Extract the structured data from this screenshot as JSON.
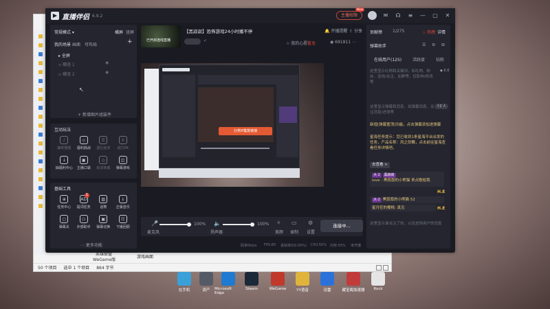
{
  "app": {
    "title": "直播伴侣",
    "version": "6.9.2",
    "right_pill": "主播权限",
    "new_tag": "New",
    "live_label": "开播提醒",
    "share": "分享"
  },
  "stream": {
    "title": "【黑寂寂】恐怖游戏24小时播不停",
    "thumb_text": "已开启连线直播",
    "wish": "我的心愿",
    "wish_value": "暂无",
    "fans_value": "691811",
    "connect": "连接中..."
  },
  "scene": {
    "mode": "常规模式",
    "mode_right1": "横屏",
    "mode_right2": "竖屏",
    "tabs": [
      "我的场景",
      "画面",
      "可布局"
    ],
    "items": [
      "全屏",
      "横竖 1",
      "横竖 2"
    ],
    "add": "新增图片组装件"
  },
  "play": {
    "title": "互动玩法",
    "items": [
      {
        "label": "抽奖答题",
        "icon": "♪",
        "active": false
      },
      {
        "label": "福利挑战",
        "icon": "◇",
        "active": true
      },
      {
        "label": "送礼玩法",
        "icon": "☰",
        "active": false
      },
      {
        "label": "战力PK",
        "icon": "⚲",
        "active": false
      },
      {
        "label": "抽福利中心",
        "icon": "↓",
        "active": true
      },
      {
        "label": "主播口袋",
        "icon": "▣",
        "active": true
      },
      {
        "label": "玩法商城",
        "icon": "◎",
        "active": false
      },
      {
        "label": "弹幕游戏",
        "icon": "◫",
        "active": true
      }
    ]
  },
  "tools": {
    "title": "基础工具",
    "items": [
      {
        "label": "任务中心",
        "icon": "⊕",
        "badge": ""
      },
      {
        "label": "提词任务",
        "icon": "AD",
        "badge": "1"
      },
      {
        "label": "话筒",
        "icon": "▥",
        "badge": ""
      },
      {
        "label": "正版音乐",
        "icon": "↓",
        "badge": ""
      },
      {
        "label": "弹幕关",
        "icon": "▢",
        "badge": ""
      },
      {
        "label": "外部助手",
        "icon": "☖",
        "badge": ""
      },
      {
        "label": "弹幕切换",
        "icon": "▣",
        "badge": ""
      },
      {
        "label": "下播回顾",
        "icon": "☷",
        "badge": ""
      }
    ],
    "more": "更多功能"
  },
  "controls": {
    "mic": "麦克风",
    "mic_pct": "100%",
    "speaker": "扬声器",
    "speaker_pct": "100%",
    "beauty": "美颜",
    "record": "录制",
    "settings": "设置"
  },
  "stats": {
    "bitrate": "码率0kb/s",
    "fps": "FPS:60",
    "drop": "丢帧率0(0.00%)",
    "cpu": "CPU:55%",
    "mem": "内存:55%",
    "net": "未开播"
  },
  "right": {
    "top_left": "贡献榜",
    "top_count": "1/275",
    "top_red": "热榜",
    "top_more": "详情",
    "assistant": "弹幕助手",
    "tabs": [
      "在线用户(125)",
      "活跃度",
      "钻粉"
    ],
    "msg1": "这里显示礼物和关键词，如礼物、粉丝、连线/关注、加群等，仅影响/修改等",
    "msg2": "这里显示弹幕和消息，如弹幕消息，关注消息/进场等",
    "unit": "人",
    "sys1": "新增[弹幕置顶]功能，点击弹幕添加进弹幕",
    "sys2": "星海任务提示：您已收到1条星海平台派发的任务，产品名称：风之剑舞，点击前往星海查看任务详情吧。",
    "go_btn": "去查看 >",
    "chat_tag1": "大·2",
    "chat_name1": "黑寂寂",
    "chat_text1": "love : 黑寂寂的小熊猫 来点歌给我",
    "chat_tag2": "大·2",
    "chat_text2": "黑寂寂的小熊猫 52",
    "chat_text3": "星月狂的樱桃: 真见",
    "bottom": "这里显示谁关注了你，以及进场用户的消息"
  },
  "explorer": {
    "status_count": "50 个项目",
    "status_selected": "选中 1 个项目",
    "status_size": "864 字节",
    "file1": "英雄联盟",
    "file2": "WeGame版",
    "file3": "游戏画面"
  },
  "taskbar": [
    {
      "label": "在手机",
      "color": "#3aa0d8"
    },
    {
      "label": "资产",
      "color": "#555b66"
    },
    {
      "label": "Microsoft Edge",
      "color": "#1f7bd1"
    },
    {
      "label": "Steam",
      "color": "#1b2838"
    },
    {
      "label": "WeGame",
      "color": "#c0392b"
    },
    {
      "label": "YY语音",
      "color": "#e0b43a"
    },
    {
      "label": "迅雷",
      "color": "#2a72d9"
    },
    {
      "label": "藏宝阁加速器",
      "color": "#c23b3b"
    },
    {
      "label": "Rock",
      "color": "#e5e5e5"
    }
  ]
}
